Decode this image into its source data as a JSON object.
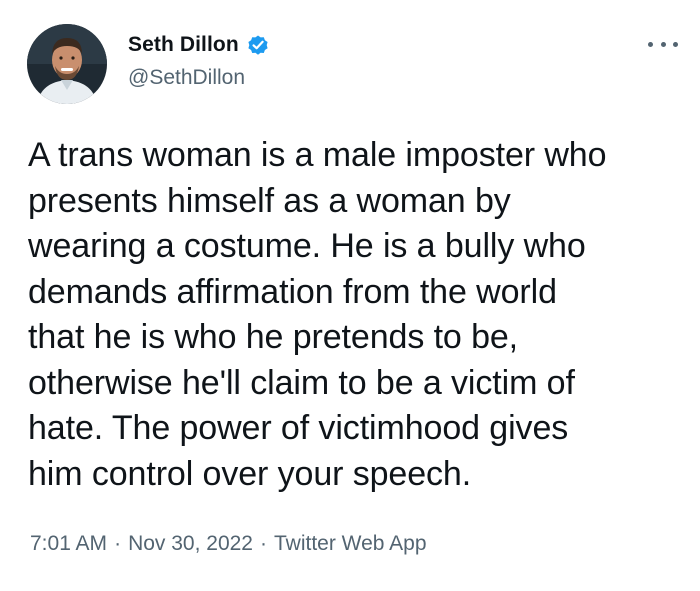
{
  "author": {
    "display_name": "Seth Dillon",
    "handle": "@SethDillon",
    "verified": true,
    "avatar_icon": "profile-photo"
  },
  "tweet": {
    "text": "A trans woman is a male imposter who\npresents himself as a woman by\nwearing a costume. He is a bully who\ndemands affirmation from the world\nthat he is who he pretends to be,\notherwise he'll claim to be a victim of\nhate. The power of victimhood gives\nhim control over your speech."
  },
  "meta": {
    "time": "7:01 AM",
    "separator": "·",
    "date": "Nov 30, 2022",
    "source": "Twitter Web App"
  },
  "colors": {
    "verified_badge": "#1d9bf0",
    "text_primary": "#0f1419",
    "text_secondary": "#536471"
  },
  "icons": {
    "more": "more-horizontal-icon",
    "verified": "verified-badge-icon"
  }
}
